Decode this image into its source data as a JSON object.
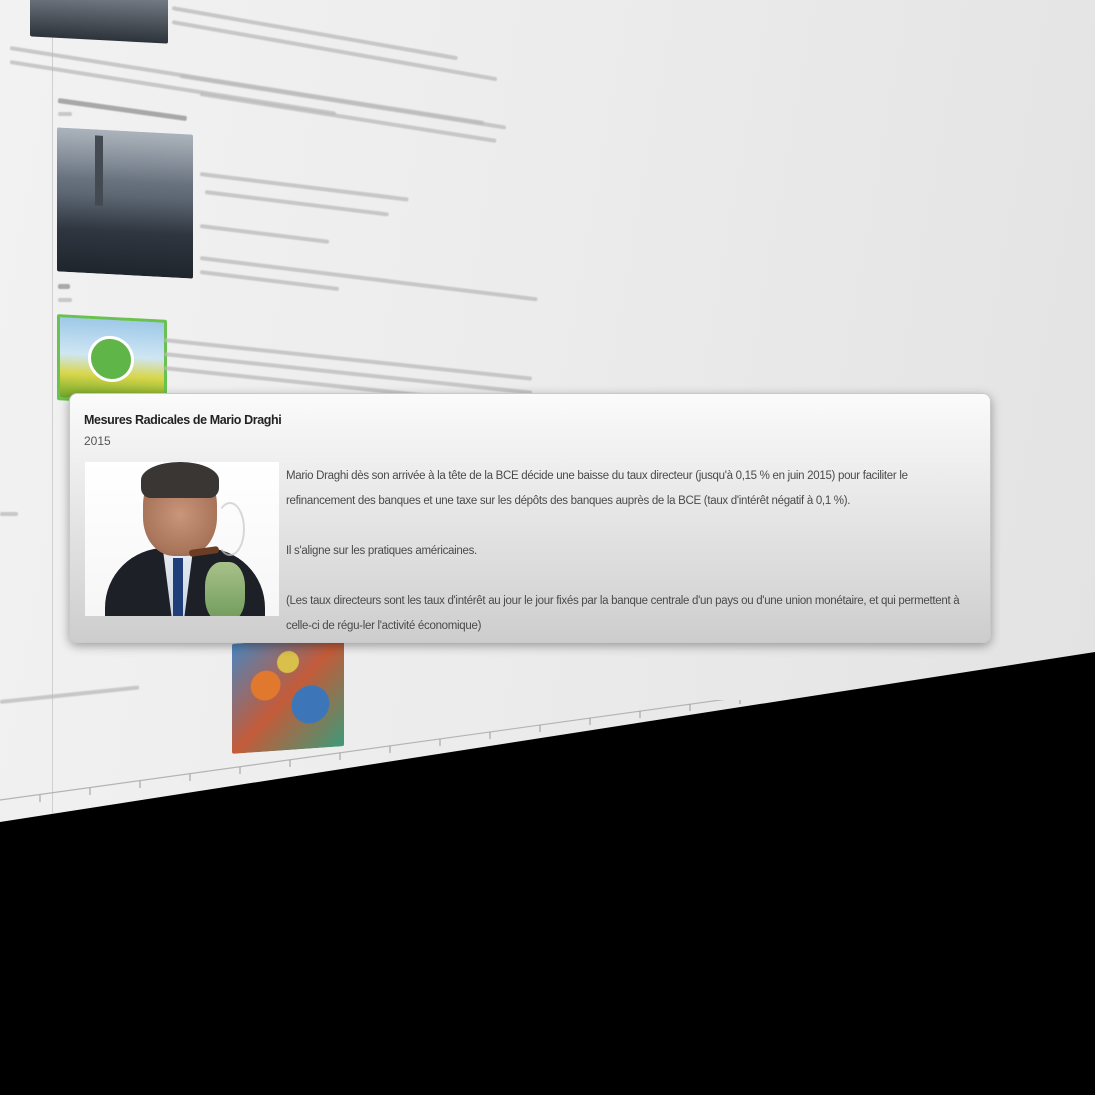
{
  "popup": {
    "title": "Mesures Radicales de Mario Draghi",
    "year": "2015",
    "image": "portrait of Mario Draghi with cigar",
    "paragraphs": [
      "Mario Draghi dès son arrivée à la tête de la BCE décide une baisse du taux directeur (jusqu'à 0,15 % en juin 2015) pour faciliter le refinancement des banques et une taxe sur les dépôts des banques auprès de la BCE (taux d'intérêt négatif à 0,1 %).",
      "Il s'aligne sur les pratiques américaines.",
      "(Les taux directeurs sont les taux d'intérêt au jour le jour fixés par la banque centrale d'un pays ou d'une union monétaire, et qui permettent à celle-ci de régu-ler l'activité économique)"
    ]
  },
  "colors": {
    "page_background": "#eeeeee",
    "card_background": "#e6e6e6",
    "green_accent": "#69c24f"
  }
}
